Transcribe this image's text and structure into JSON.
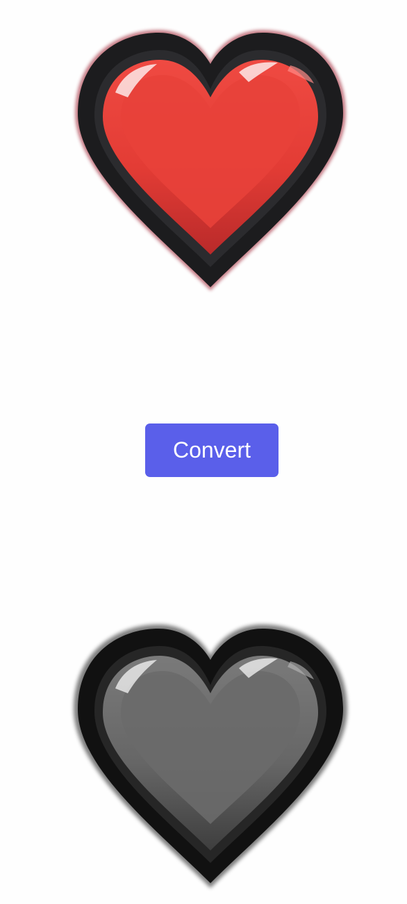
{
  "images": {
    "original": {
      "icon": "red-heart-icon",
      "fill_color": "#e8413a",
      "outline_color": "#1c1c1e",
      "glow_color": "#a32a3a"
    },
    "converted": {
      "icon": "gray-heart-icon",
      "fill_color": "#6a6a6a",
      "outline_color": "#111111",
      "glow_color": "#000000"
    }
  },
  "actions": {
    "convert_label": "Convert",
    "convert_color": "#5a5fea"
  }
}
